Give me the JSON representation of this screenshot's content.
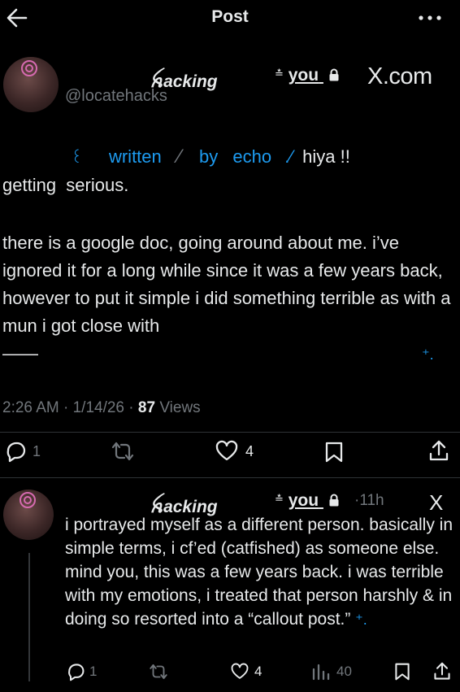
{
  "header": {
    "title": "Post"
  },
  "post": {
    "name": "ꫝacking",
    "handle": "@locatehacks",
    "you_label": "you",
    "sign": "≛",
    "site": "X.com",
    "intro": {
      "ornament": "꒰",
      "written": "written",
      "slash": "⁄",
      "by": "by",
      "echo": "echo",
      "mark": ".⁄",
      "greeting": "hiya !!",
      "line2": "getting  serious."
    },
    "paragraph": "there is a google doc, going around about me. i’ve ignored it for a long while since it was a few years back, however to put it simple i did something terrible as with a mun i got close with",
    "tail_dash": "——",
    "tail_arrow": "⁺.",
    "time": "2:26 AM",
    "date": "1/14/26",
    "views_count": "87",
    "views_label": "Views",
    "replies": "1",
    "likes": "4"
  },
  "reply": {
    "name": "ꫝacking",
    "you_label": "you",
    "sign": "≛",
    "time": "11h",
    "site_icon": "X",
    "text": "i portrayed myself as a different person. basically in simple terms, i cf’ed (catfished) as someone else. mind you, this was a few years back. i was terrible with my emotions, i treated that person harshly & in doing so resorted into a “callout post.”",
    "tail_arrow": "⁺.",
    "replies": "1",
    "likes": "4",
    "views": "40"
  }
}
